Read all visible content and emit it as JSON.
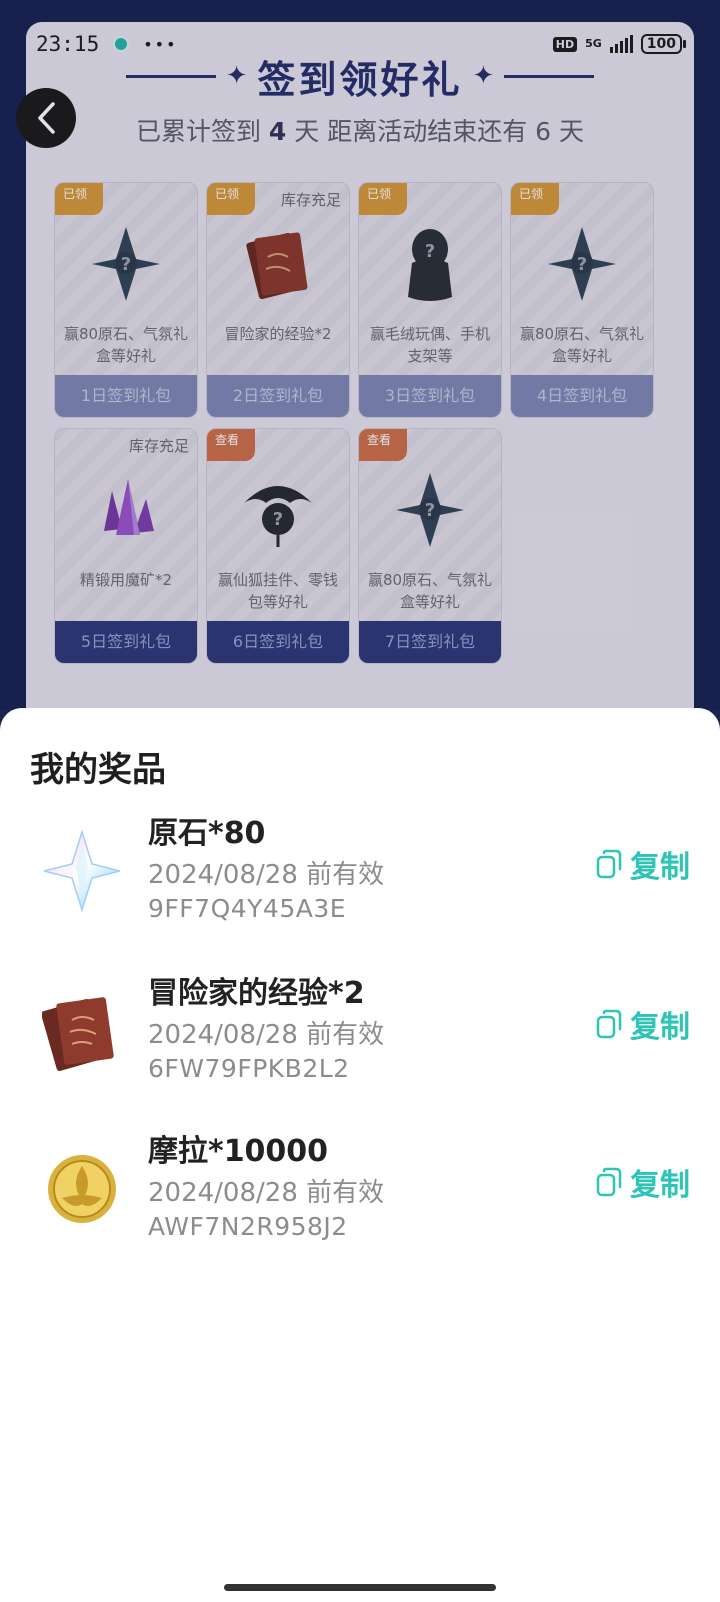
{
  "status_bar": {
    "time": "23:15",
    "more": "•••",
    "hd": "HD",
    "network": "5G",
    "battery": "100"
  },
  "event": {
    "title": "签到领好礼",
    "sign_prefix": "已累计签到",
    "sign_days": "4",
    "sign_mid": "天  距离活动结束还有",
    "remain_days": "6",
    "sign_suffix": "天"
  },
  "cards": [
    {
      "tag": "已领",
      "stock": "",
      "desc": "赢80原石、气氛礼盒等好礼",
      "footer": "1日签到礼包",
      "icon": "mystery-star-icon"
    },
    {
      "tag": "已领",
      "stock": "库存充足",
      "desc": "冒险家的经验*2",
      "footer": "2日签到礼包",
      "icon": "adventurer-book-icon"
    },
    {
      "tag": "已领",
      "stock": "",
      "desc": "赢毛绒玩偶、手机支架等",
      "footer": "3日签到礼包",
      "icon": "mystery-figure-icon"
    },
    {
      "tag": "已领",
      "stock": "",
      "desc": "赢80原石、气氛礼盒等好礼",
      "footer": "4日签到礼包",
      "icon": "mystery-star-icon"
    },
    {
      "tag": "",
      "stock": "库存充足",
      "desc": "精锻用魔矿*2",
      "footer": "5日签到礼包",
      "icon": "crystal-ore-icon"
    },
    {
      "tag": "查看",
      "stock": "",
      "desc": "赢仙狐挂件、零钱包等好礼",
      "footer": "6日签到礼包",
      "icon": "mystery-umbrella-icon"
    },
    {
      "tag": "查看",
      "stock": "",
      "desc": "赢80原石、气氛礼盒等好礼",
      "footer": "7日签到礼包",
      "icon": "mystery-star-icon"
    }
  ],
  "prizes_sheet": {
    "title": "我的奖品",
    "copy_label": "复制",
    "items": [
      {
        "name": "原石*80",
        "expiry": "2024/08/28 前有效",
        "code": "9FF7Q4Y45A3E",
        "icon": "primogem-icon"
      },
      {
        "name": "冒险家的经验*2",
        "expiry": "2024/08/28 前有效",
        "code": "6FW79FPKB2L2",
        "icon": "adventurer-book-icon"
      },
      {
        "name": "摩拉*10000",
        "expiry": "2024/08/28 前有效",
        "code": "AWF7N2R958J2",
        "icon": "mora-coin-icon"
      }
    ]
  }
}
